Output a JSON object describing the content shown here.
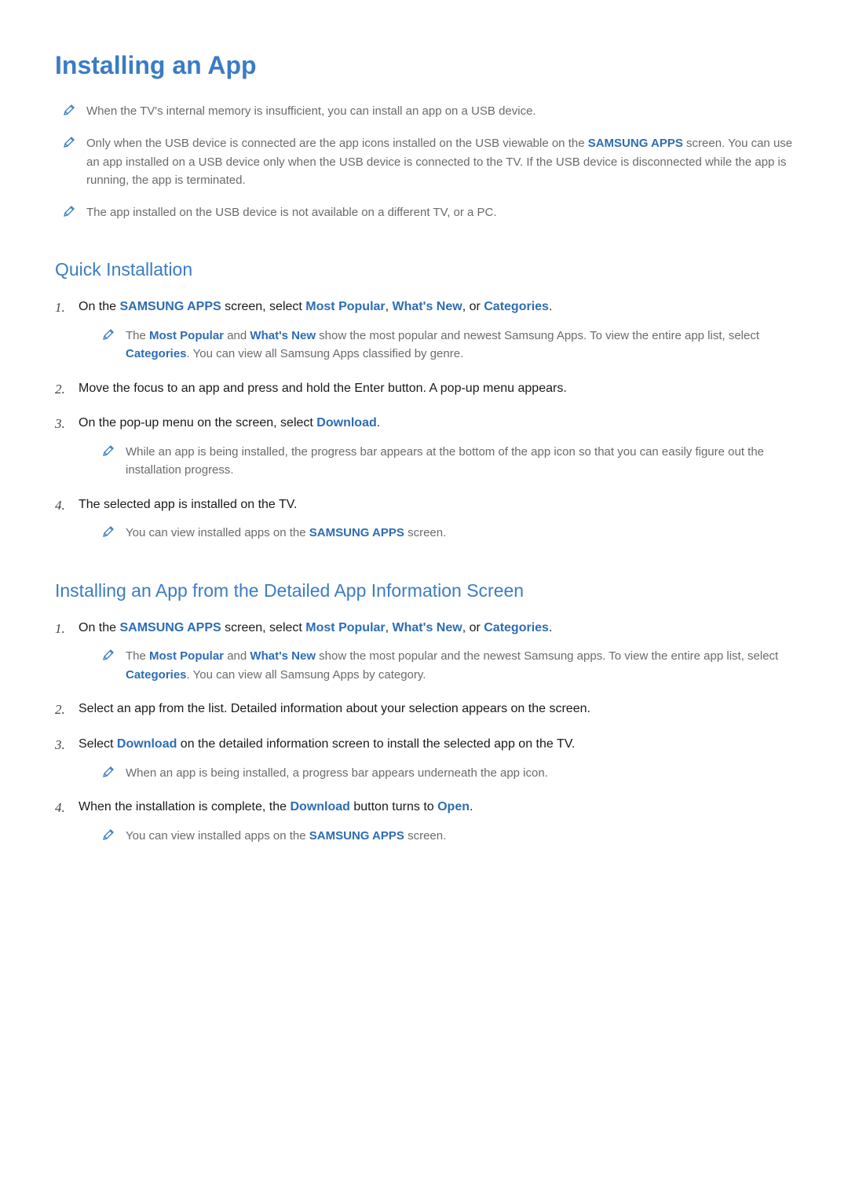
{
  "title": "Installing an App",
  "top_notes": [
    {
      "segments": [
        {
          "t": "plain",
          "v": "When the TV's internal memory is insufficient, you can install an app on a USB device."
        }
      ]
    },
    {
      "segments": [
        {
          "t": "plain",
          "v": "Only when the USB device is connected are the app icons installed on the USB viewable on the "
        },
        {
          "t": "link",
          "v": "SAMSUNG APPS"
        },
        {
          "t": "plain",
          "v": " screen. You can use an app installed on a USB device only when the USB device is connected to the TV. If the USB device is disconnected while the app is running, the app is terminated."
        }
      ]
    },
    {
      "segments": [
        {
          "t": "plain",
          "v": "The app installed on the USB device is not available on a different TV, or a PC."
        }
      ]
    }
  ],
  "section1": {
    "heading": "Quick Installation",
    "steps": [
      {
        "segments": [
          {
            "t": "plain",
            "v": "On the "
          },
          {
            "t": "link",
            "v": "SAMSUNG APPS"
          },
          {
            "t": "plain",
            "v": " screen, select "
          },
          {
            "t": "link",
            "v": "Most Popular"
          },
          {
            "t": "plain",
            "v": ", "
          },
          {
            "t": "link",
            "v": "What's New"
          },
          {
            "t": "plain",
            "v": ", or "
          },
          {
            "t": "link",
            "v": "Categories"
          },
          {
            "t": "period",
            "v": "."
          }
        ],
        "notes": [
          {
            "segments": [
              {
                "t": "plain",
                "v": "The "
              },
              {
                "t": "link",
                "v": "Most Popular"
              },
              {
                "t": "plain",
                "v": " and "
              },
              {
                "t": "link",
                "v": "What's New"
              },
              {
                "t": "plain",
                "v": " show the most popular and newest Samsung Apps. To view the entire app list, select "
              },
              {
                "t": "link",
                "v": "Categories"
              },
              {
                "t": "plain",
                "v": ". You can view all Samsung Apps classified by genre."
              }
            ]
          }
        ]
      },
      {
        "segments": [
          {
            "t": "plain",
            "v": "Move the focus to an app and press and hold the Enter button. A pop-up menu appears."
          }
        ]
      },
      {
        "segments": [
          {
            "t": "plain",
            "v": "On the pop-up menu on the screen, select "
          },
          {
            "t": "link",
            "v": "Download"
          },
          {
            "t": "period",
            "v": "."
          }
        ],
        "notes": [
          {
            "segments": [
              {
                "t": "plain",
                "v": "While an app is being installed, the progress bar appears at the bottom of the app icon so that you can easily figure out the installation progress."
              }
            ]
          }
        ]
      },
      {
        "segments": [
          {
            "t": "plain",
            "v": "The selected app is installed on the TV."
          }
        ],
        "notes": [
          {
            "segments": [
              {
                "t": "plain",
                "v": "You can view installed apps on the "
              },
              {
                "t": "link",
                "v": "SAMSUNG APPS"
              },
              {
                "t": "plain",
                "v": " screen."
              }
            ]
          }
        ]
      }
    ]
  },
  "section2": {
    "heading": "Installing an App from the Detailed App Information Screen",
    "steps": [
      {
        "segments": [
          {
            "t": "plain",
            "v": "On the "
          },
          {
            "t": "link",
            "v": "SAMSUNG APPS"
          },
          {
            "t": "plain",
            "v": " screen, select "
          },
          {
            "t": "link",
            "v": "Most Popular"
          },
          {
            "t": "plain",
            "v": ", "
          },
          {
            "t": "link",
            "v": "What's New"
          },
          {
            "t": "plain",
            "v": ", or "
          },
          {
            "t": "link",
            "v": "Categories"
          },
          {
            "t": "period",
            "v": "."
          }
        ],
        "notes": [
          {
            "segments": [
              {
                "t": "plain",
                "v": "The "
              },
              {
                "t": "link",
                "v": "Most Popular"
              },
              {
                "t": "plain",
                "v": " and "
              },
              {
                "t": "link",
                "v": "What's New"
              },
              {
                "t": "plain",
                "v": " show the most popular and the newest Samsung apps. To view the entire app list, select "
              },
              {
                "t": "link",
                "v": "Categories"
              },
              {
                "t": "plain",
                "v": ". You can view all Samsung Apps by category."
              }
            ]
          }
        ]
      },
      {
        "segments": [
          {
            "t": "plain",
            "v": "Select an app from the list. Detailed information about your selection appears on the screen."
          }
        ]
      },
      {
        "segments": [
          {
            "t": "plain",
            "v": "Select "
          },
          {
            "t": "link",
            "v": "Download"
          },
          {
            "t": "plain",
            "v": " on the detailed information screen to install the selected app on the TV."
          }
        ],
        "notes": [
          {
            "segments": [
              {
                "t": "plain",
                "v": "When an app is being installed, a progress bar appears underneath the app icon."
              }
            ]
          }
        ]
      },
      {
        "segments": [
          {
            "t": "plain",
            "v": "When the installation is complete, the "
          },
          {
            "t": "link",
            "v": "Download"
          },
          {
            "t": "plain",
            "v": " button turns to "
          },
          {
            "t": "link",
            "v": "Open"
          },
          {
            "t": "period",
            "v": "."
          }
        ],
        "notes": [
          {
            "segments": [
              {
                "t": "plain",
                "v": "You can view installed apps on the "
              },
              {
                "t": "link",
                "v": "SAMSUNG APPS"
              },
              {
                "t": "plain",
                "v": " screen."
              }
            ]
          }
        ]
      }
    ]
  }
}
